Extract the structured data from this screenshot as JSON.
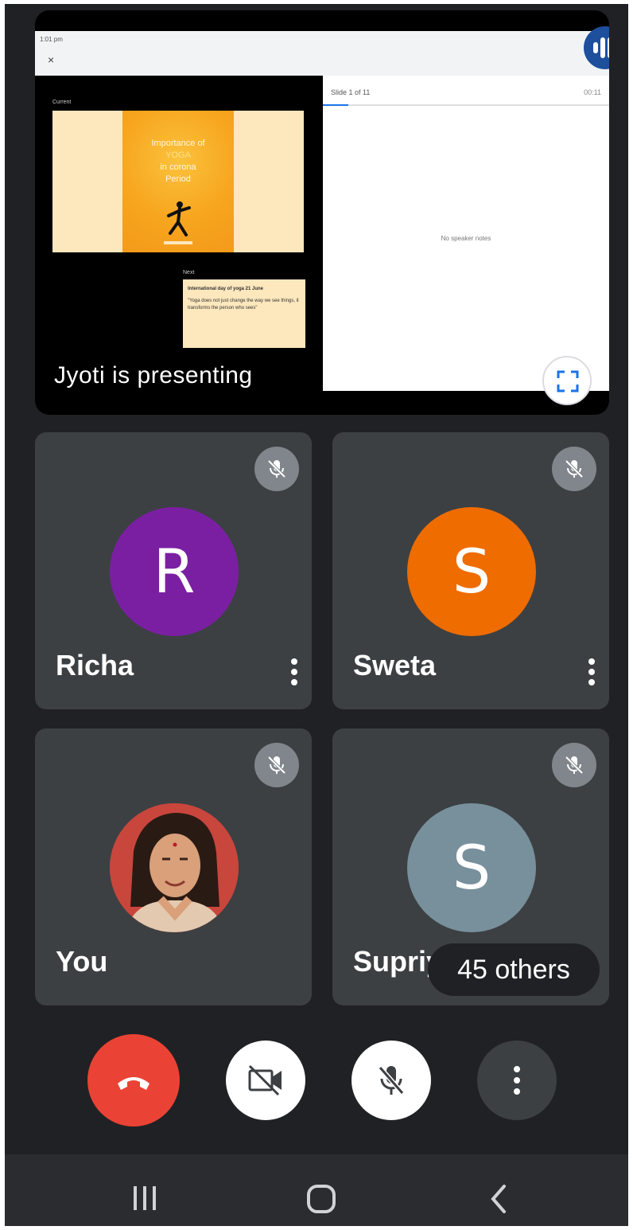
{
  "presentation": {
    "presenter_label": "Jyoti is presenting",
    "shared_screen": {
      "status_time": "1:01 pm",
      "close_glyph": "×",
      "current_label": "Current",
      "slide_title_line1": "Importance of",
      "slide_title_line2": "YOGA",
      "slide_title_line3": "in corona",
      "slide_title_line4": "Period",
      "next_label": "Next",
      "next_slide_heading": "International day of yoga 21 June",
      "next_slide_quote": "\"Yoga does not just change the way we see things, it transforms the person who sees\"",
      "slide_counter": "Slide 1 of 11",
      "slide_timer": "00:11",
      "slide_progress": 0.09,
      "speaker_notes": "No speaker notes"
    }
  },
  "participants": [
    {
      "name": "Richa",
      "initial": "R",
      "avatar_color": "#7b1fa2",
      "muted": true,
      "has_menu": true
    },
    {
      "name": "Sweta",
      "initial": "S",
      "avatar_color": "#ef6c00",
      "muted": true,
      "has_menu": true
    },
    {
      "name": "You",
      "initial": "",
      "avatar_color": "#c9463d",
      "muted": true,
      "has_menu": false
    },
    {
      "name": "Supriya",
      "initial": "S",
      "avatar_color": "#78909c",
      "muted": true,
      "has_menu": false
    }
  ],
  "others_chip": "45 others",
  "controls": {
    "end_call": {
      "icon": "phone-hangup-icon",
      "color": "#ea4335"
    },
    "camera": {
      "icon": "camera-off-icon",
      "color": "#ffffff"
    },
    "microphone": {
      "icon": "mic-off-icon",
      "color": "#ffffff"
    },
    "more": {
      "icon": "more-vert-icon",
      "color": "#3c4043"
    }
  },
  "nav": {
    "recents": "recents-icon",
    "home": "home-icon",
    "back": "back-icon"
  }
}
